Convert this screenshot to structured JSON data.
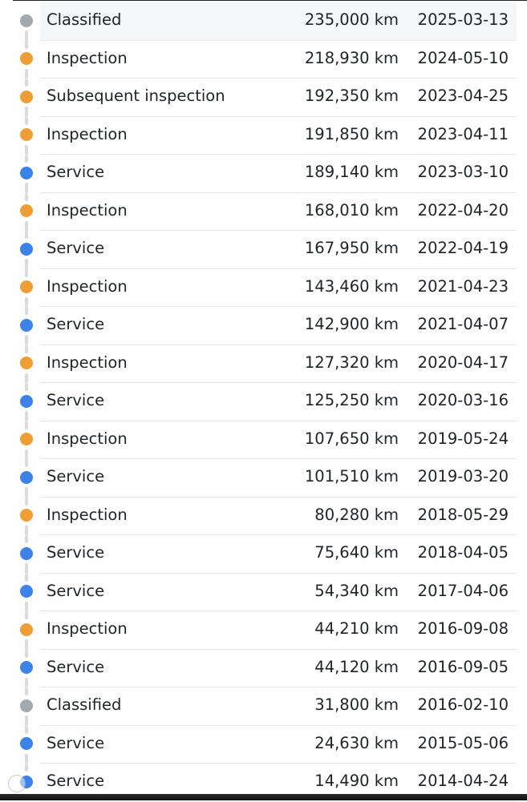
{
  "colors": {
    "classified": "#a4a9ae",
    "inspection": "#ef9e35",
    "service": "#3d82e8",
    "connector": "#d6dbe0"
  },
  "history": [
    {
      "type": "classified",
      "label": "Classified",
      "km": "235,000 km",
      "date": "2025-03-13"
    },
    {
      "type": "inspection",
      "label": "Inspection",
      "km": "218,930 km",
      "date": "2024-05-10"
    },
    {
      "type": "inspection",
      "label": "Subsequent inspection",
      "km": "192,350 km",
      "date": "2023-04-25"
    },
    {
      "type": "inspection",
      "label": "Inspection",
      "km": "191,850 km",
      "date": "2023-04-11"
    },
    {
      "type": "service",
      "label": "Service",
      "km": "189,140 km",
      "date": "2023-03-10"
    },
    {
      "type": "inspection",
      "label": "Inspection",
      "km": "168,010 km",
      "date": "2022-04-20"
    },
    {
      "type": "service",
      "label": "Service",
      "km": "167,950 km",
      "date": "2022-04-19"
    },
    {
      "type": "inspection",
      "label": "Inspection",
      "km": "143,460 km",
      "date": "2021-04-23"
    },
    {
      "type": "service",
      "label": "Service",
      "km": "142,900 km",
      "date": "2021-04-07"
    },
    {
      "type": "inspection",
      "label": "Inspection",
      "km": "127,320 km",
      "date": "2020-04-17"
    },
    {
      "type": "service",
      "label": "Service",
      "km": "125,250 km",
      "date": "2020-03-16"
    },
    {
      "type": "inspection",
      "label": "Inspection",
      "km": "107,650 km",
      "date": "2019-05-24"
    },
    {
      "type": "service",
      "label": "Service",
      "km": "101,510 km",
      "date": "2019-03-20"
    },
    {
      "type": "inspection",
      "label": "Inspection",
      "km": "80,280 km",
      "date": "2018-05-29"
    },
    {
      "type": "service",
      "label": "Service",
      "km": "75,640 km",
      "date": "2018-04-05"
    },
    {
      "type": "service",
      "label": "Service",
      "km": "54,340 km",
      "date": "2017-04-06"
    },
    {
      "type": "inspection",
      "label": "Inspection",
      "km": "44,210 km",
      "date": "2016-09-08"
    },
    {
      "type": "service",
      "label": "Service",
      "km": "44,120 km",
      "date": "2016-09-05"
    },
    {
      "type": "classified",
      "label": "Classified",
      "km": "31,800 km",
      "date": "2016-02-10"
    },
    {
      "type": "service",
      "label": "Service",
      "km": "24,630 km",
      "date": "2015-05-06"
    },
    {
      "type": "service",
      "label": "Service",
      "km": "14,490 km",
      "date": "2014-04-24"
    }
  ]
}
